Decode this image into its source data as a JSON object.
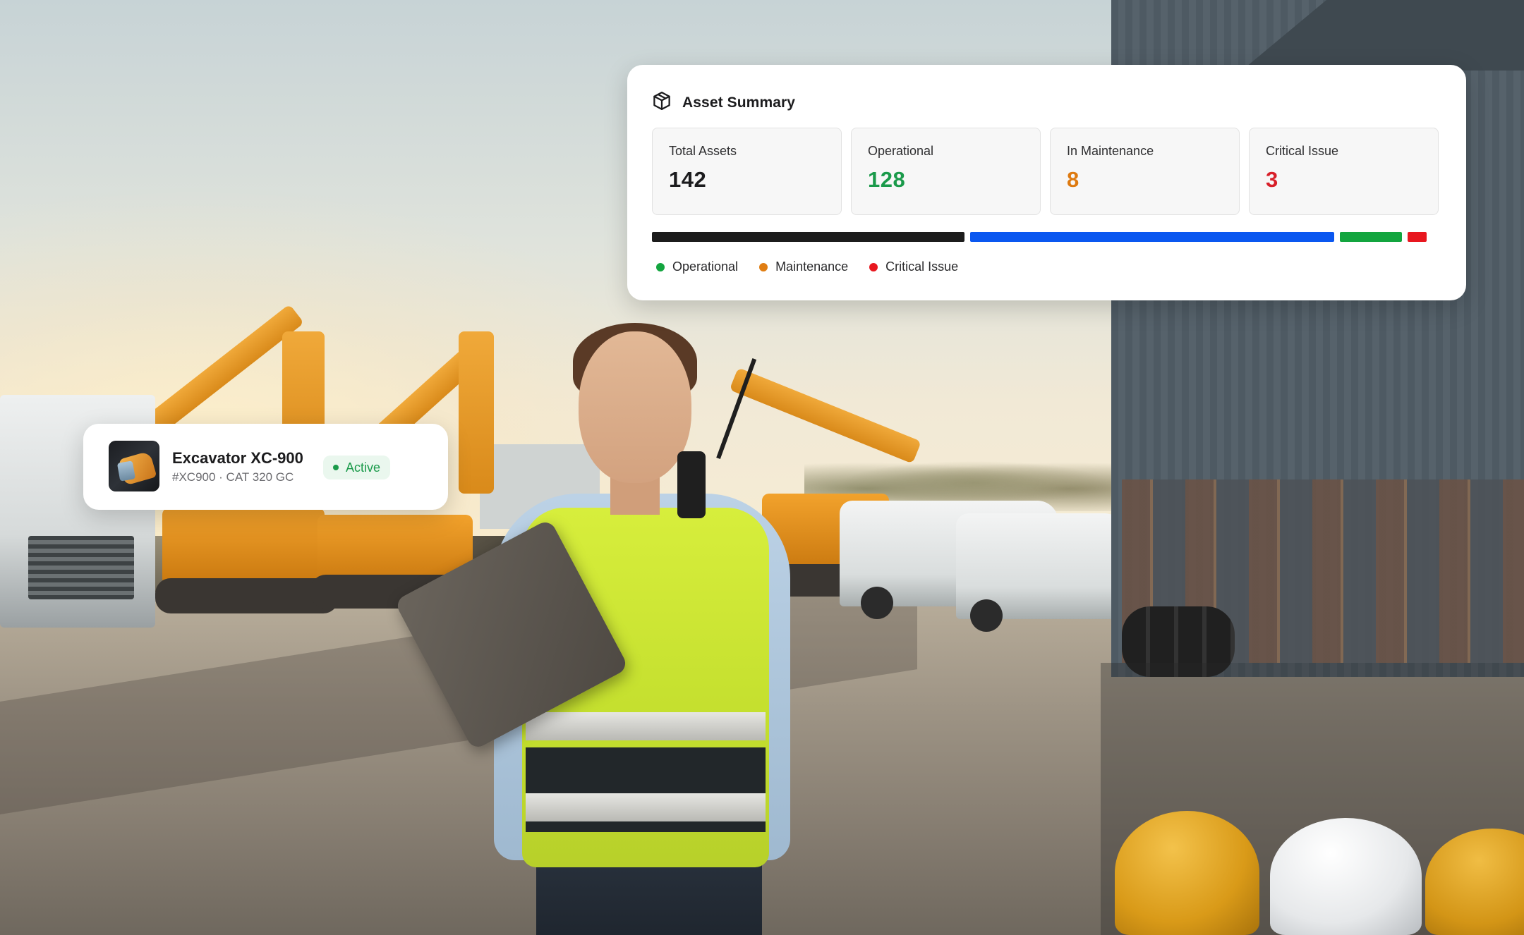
{
  "asset_summary": {
    "title": "Asset Summary",
    "icon": "cube-icon",
    "stats": [
      {
        "label": "Total Assets",
        "value": "142",
        "color": "#1c1c1e"
      },
      {
        "label": "Operational",
        "value": "128",
        "color": "#1a9a4a"
      },
      {
        "label": "In Maintenance",
        "value": "8",
        "color": "#de7a10"
      },
      {
        "label": "Critical Issue",
        "value": "3",
        "color": "#d8202a"
      }
    ],
    "distribution_bar": [
      {
        "color": "#1c1c1c",
        "share": 0.406
      },
      {
        "color": "#0a57f0",
        "share": 0.473
      },
      {
        "color": "#13a53f",
        "share": 0.081
      },
      {
        "color": "#e8171f",
        "share": 0.025
      }
    ],
    "legend": [
      {
        "label": "Operational",
        "color": "#13a53f"
      },
      {
        "label": "Maintenance",
        "color": "#e07d12"
      },
      {
        "label": "Critical Issue",
        "color": "#e8171f"
      }
    ]
  },
  "equipment": {
    "name": "Excavator XC-900",
    "meta": "#XC900 · CAT 320 GC",
    "status": "Active",
    "status_color": "#1a9a4a"
  }
}
